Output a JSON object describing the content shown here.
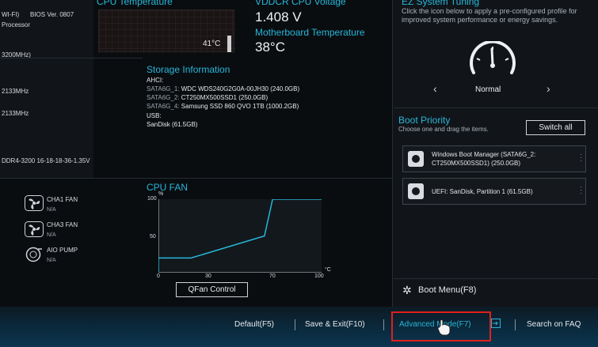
{
  "system": {
    "wifi_text": "WI-FI)",
    "bios_version": "BIOS Ver. 0807",
    "processor_label": "Processor",
    "mem_speed": "3200MHz)",
    "dram_a": "2133MHz",
    "dram_b": "2133MHz",
    "xmp": "DDR4-3200 16-18-18-36-1.35V"
  },
  "cpu_temp": {
    "title": "CPU Temperature",
    "value": "41°C"
  },
  "voltage": {
    "title": "VDDCR CPU Voltage",
    "value": "1.408 V"
  },
  "mb_temp": {
    "title": "Motherboard Temperature",
    "value": "38°C"
  },
  "storage": {
    "title": "Storage Information",
    "ahci_label": "AHCI:",
    "sata": [
      {
        "port": "SATA6G_1:",
        "device": "WDC WDS240G2G0A-00JH30 (240.0GB)"
      },
      {
        "port": "SATA6G_2:",
        "device": "CT250MX500SSD1 (250.0GB)"
      },
      {
        "port": "SATA6G_4:",
        "device": "Samsung SSD 860 QVO 1TB (1000.2GB)"
      }
    ],
    "usb_label": "USB:",
    "usb_device": "SanDisk (61.5GB)"
  },
  "fans": [
    {
      "name": "CHA1 FAN",
      "value": "N/A",
      "icon": "fan-icon"
    },
    {
      "name": "CHA3 FAN",
      "value": "N/A",
      "icon": "fan-icon"
    },
    {
      "name": "AIO PUMP",
      "value": "N/A",
      "icon": "pump-icon"
    }
  ],
  "cpu_fan": {
    "title": "CPU FAN",
    "y_unit": "%",
    "x_unit": "°C",
    "y_ticks": [
      "100",
      "50"
    ],
    "x_ticks": [
      "0",
      "30",
      "70",
      "100"
    ],
    "button_label": "QFan Control"
  },
  "chart_data": {
    "type": "line",
    "title": "CPU FAN",
    "xlabel": "°C",
    "ylabel": "%",
    "xlim": [
      0,
      100
    ],
    "ylim": [
      0,
      100
    ],
    "x": [
      0,
      0,
      20,
      65,
      70,
      100
    ],
    "series": [
      {
        "values": [
          20,
          20,
          20,
          50,
          100,
          100
        ]
      }
    ]
  },
  "ez_tuning": {
    "title": "EZ System Tuning",
    "description": "Click the icon below to apply a pre-configured profile for improved system performance or energy savings.",
    "mode": "Normal",
    "prev": "‹",
    "next": "›"
  },
  "boot": {
    "title": "Boot Priority",
    "subtitle": "Choose one and drag the items.",
    "switch_all": "Switch all",
    "items": [
      {
        "line1": "Windows Boot Manager (SATA6G_2:",
        "line2": "CT250MX500SSD1) (250.0GB)"
      },
      {
        "line1": "UEFI: SanDisk, Partition 1 (61.5GB)",
        "line2": ""
      }
    ],
    "boot_menu": "Boot Menu(F8)"
  },
  "footer": {
    "default": "Default(F5)",
    "save_exit": "Save & Exit(F10)",
    "advanced": "Advanced Mode(F7)",
    "faq": "Search on FAQ"
  },
  "colors": {
    "accent": "#27b6d8",
    "highlight": "#e0201c"
  }
}
